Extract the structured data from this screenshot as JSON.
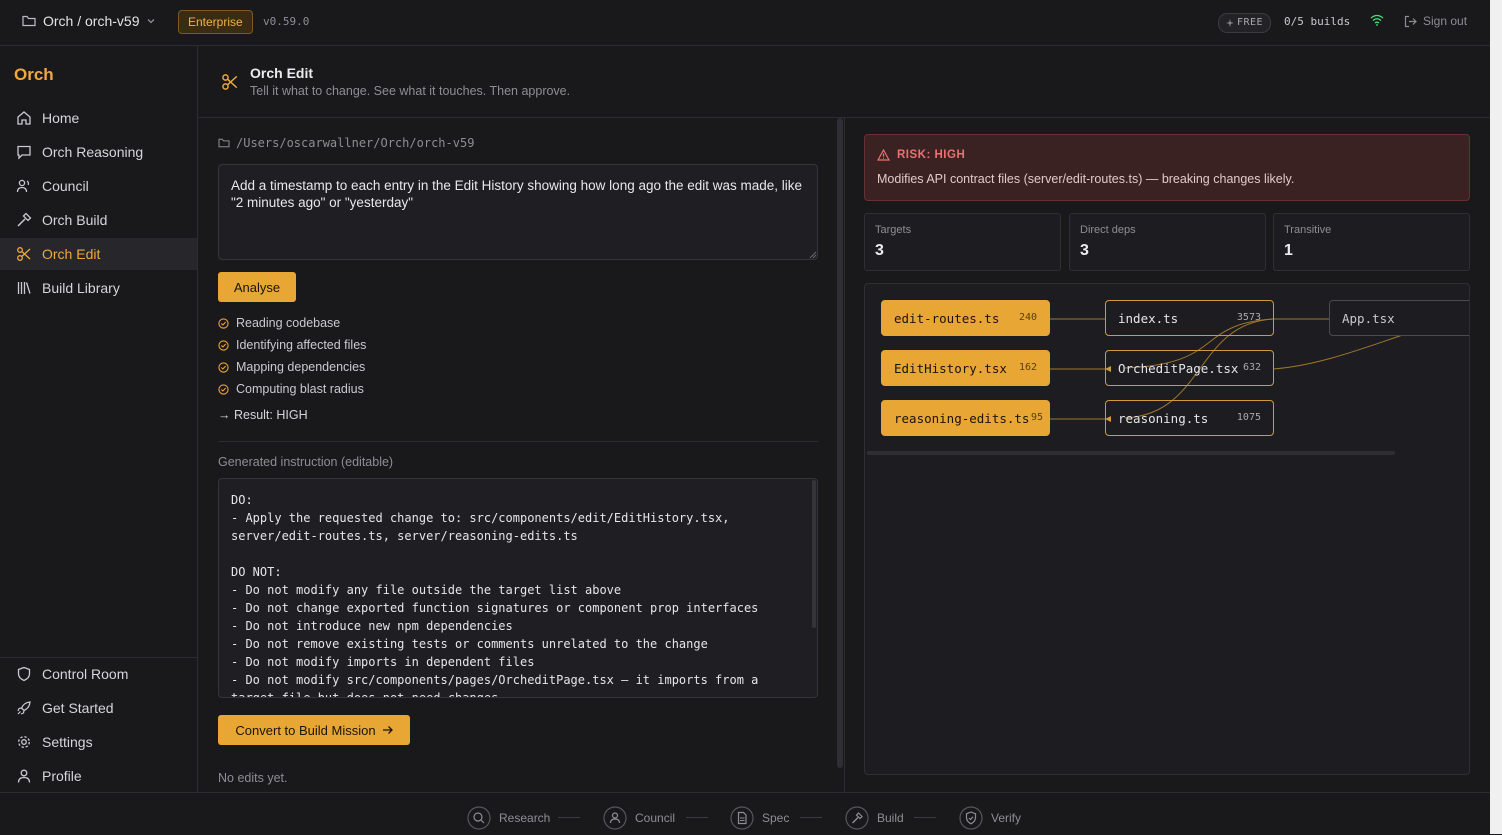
{
  "topbar": {
    "project": "Orch / orch-v59",
    "plan_badge": "Enterprise",
    "version": "v0.59.0",
    "tier": "FREE",
    "builds": "0/5 builds",
    "sign_out": "Sign out"
  },
  "sidebar": {
    "brand": "Orch",
    "items": [
      {
        "label": "Home",
        "icon": "home-icon"
      },
      {
        "label": "Orch Reasoning",
        "icon": "chat-icon"
      },
      {
        "label": "Council",
        "icon": "users-icon"
      },
      {
        "label": "Orch Build",
        "icon": "hammer-icon"
      },
      {
        "label": "Orch Edit",
        "icon": "scissors-icon",
        "active": true
      },
      {
        "label": "Build Library",
        "icon": "library-icon"
      }
    ],
    "bottom_items": [
      {
        "label": "Control Room",
        "icon": "shield-icon"
      },
      {
        "label": "Get Started",
        "icon": "rocket-icon"
      },
      {
        "label": "Settings",
        "icon": "gear-icon"
      },
      {
        "label": "Profile",
        "icon": "user-icon"
      }
    ]
  },
  "header": {
    "title": "Orch Edit",
    "subtitle": "Tell it what to change. See what it touches. Then approve."
  },
  "editor": {
    "path": "/Users/oscarwallner/Orch/orch-v59",
    "request": "Add a timestamp to each entry in the Edit History showing how long ago the edit was made, like \"2 minutes ago\" or \"yesterday\"",
    "analyse_label": "Analyse",
    "steps": [
      "Reading codebase",
      "Identifying affected files",
      "Mapping dependencies",
      "Computing blast radius"
    ],
    "result": "→ Result: HIGH",
    "generated_label": "Generated instruction (editable)",
    "instruction_lines": [
      "DO:",
      "- Apply the requested change to: src/components/edit/EditHistory.tsx,",
      "server/edit-routes.ts, server/reasoning-edits.ts",
      "",
      "DO NOT:",
      "- Do not modify any file outside the target list above",
      "- Do not change exported function signatures or component prop interfaces",
      "- Do not introduce new npm dependencies",
      "- Do not remove existing tests or comments unrelated to the change",
      "- Do not modify imports in dependent files",
      "- Do not modify src/components/pages/OrcheditPage.tsx — it imports from a",
      "target file but does not need changes"
    ],
    "convert_label": "Convert to Build Mission",
    "no_edits": "No edits yet."
  },
  "risk": {
    "heading": "RISK: HIGH",
    "description": "Modifies API contract files (server/edit-routes.ts) — breaking changes likely.",
    "color": "#ef7070"
  },
  "stats": [
    {
      "label": "Targets",
      "value": "3"
    },
    {
      "label": "Direct deps",
      "value": "3"
    },
    {
      "label": "Transitive",
      "value": "1"
    }
  ],
  "graph": {
    "targets": [
      {
        "name": "edit-routes.ts",
        "count": "240"
      },
      {
        "name": "EditHistory.tsx",
        "count": "162"
      },
      {
        "name": "reasoning-edits.ts",
        "count": "95"
      }
    ],
    "deps": [
      {
        "name": "index.ts",
        "count": "3573"
      },
      {
        "name": "OrcheditPage.tsx",
        "count": "632"
      },
      {
        "name": "reasoning.ts",
        "count": "1075"
      }
    ],
    "transitive": [
      {
        "name": "App.tsx"
      }
    ]
  },
  "pipeline": [
    "Research",
    "Council",
    "Spec",
    "Build",
    "Verify"
  ],
  "colors": {
    "accent": "#e8a634",
    "risk": "#ef7070",
    "background": "#19191c"
  }
}
